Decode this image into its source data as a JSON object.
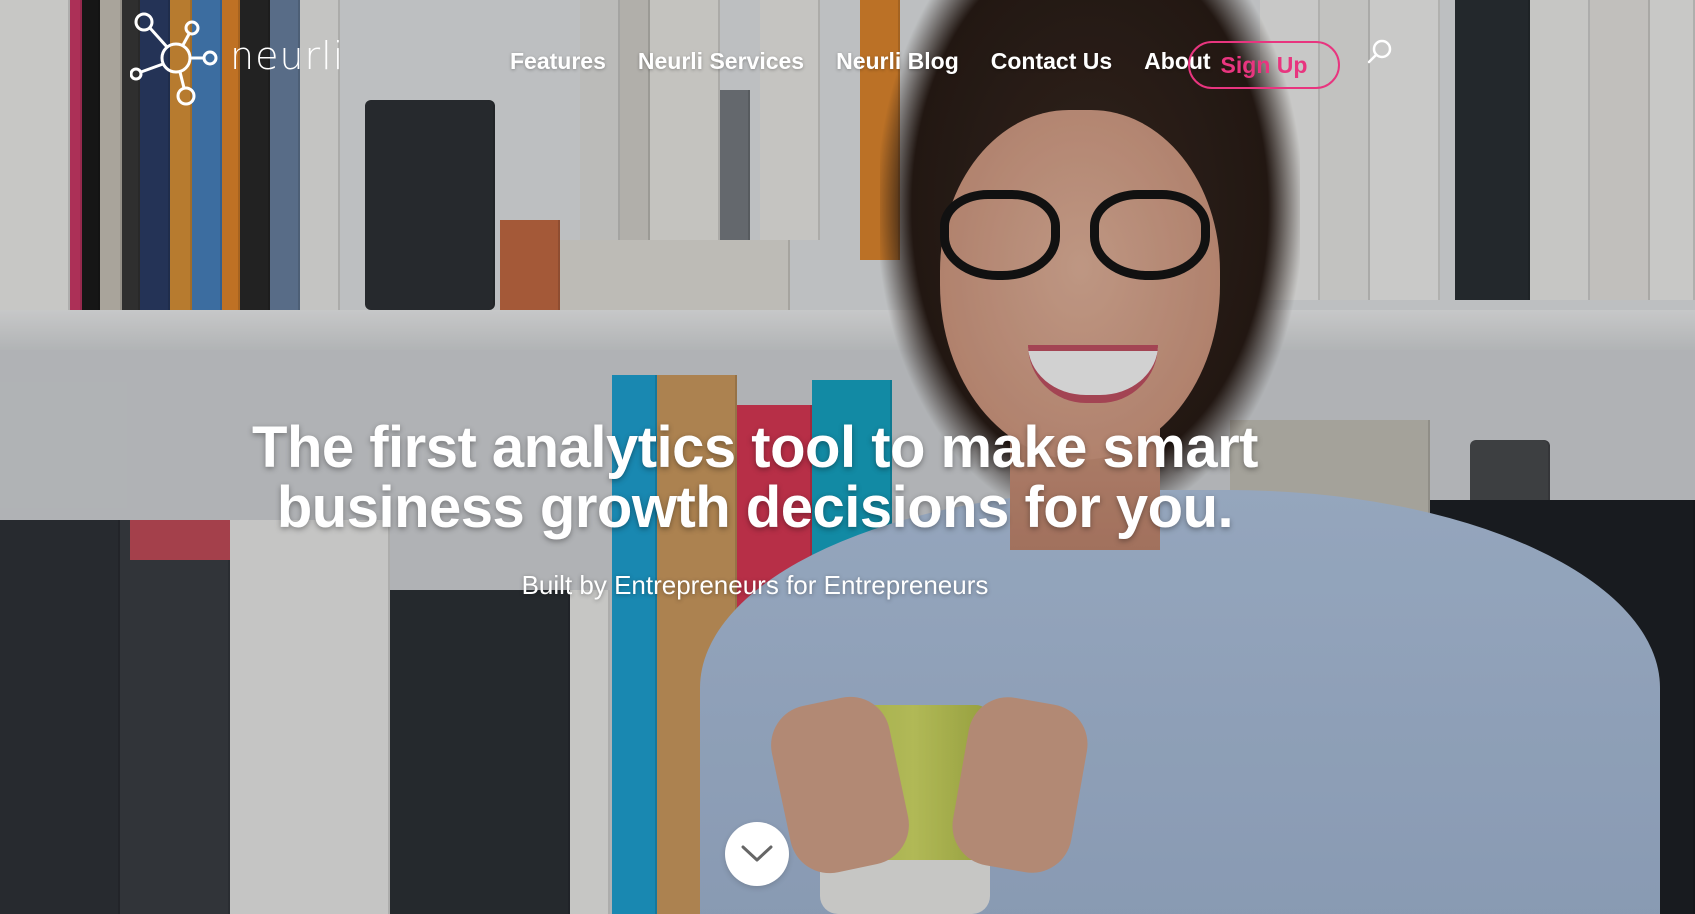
{
  "header": {
    "logo_text": "neurli",
    "nav": [
      {
        "label": "Features"
      },
      {
        "label": "Neurli Services"
      },
      {
        "label": "Neurli Blog"
      },
      {
        "label": "Contact Us"
      },
      {
        "label": "About"
      }
    ],
    "signup_label": "Sign Up",
    "search_icon": "search-icon"
  },
  "hero": {
    "headline_line1": "The first analytics tool to make smart",
    "headline_line2": "business growth decisions for you.",
    "subheadline": "Built by Entrepreneurs for Entrepreneurs",
    "scroll_icon": "chevron-down-icon"
  },
  "colors": {
    "accent": "#e8357f",
    "text_on_hero": "#ffffff",
    "button_bg": "#ffffff",
    "chevron": "#666666"
  }
}
